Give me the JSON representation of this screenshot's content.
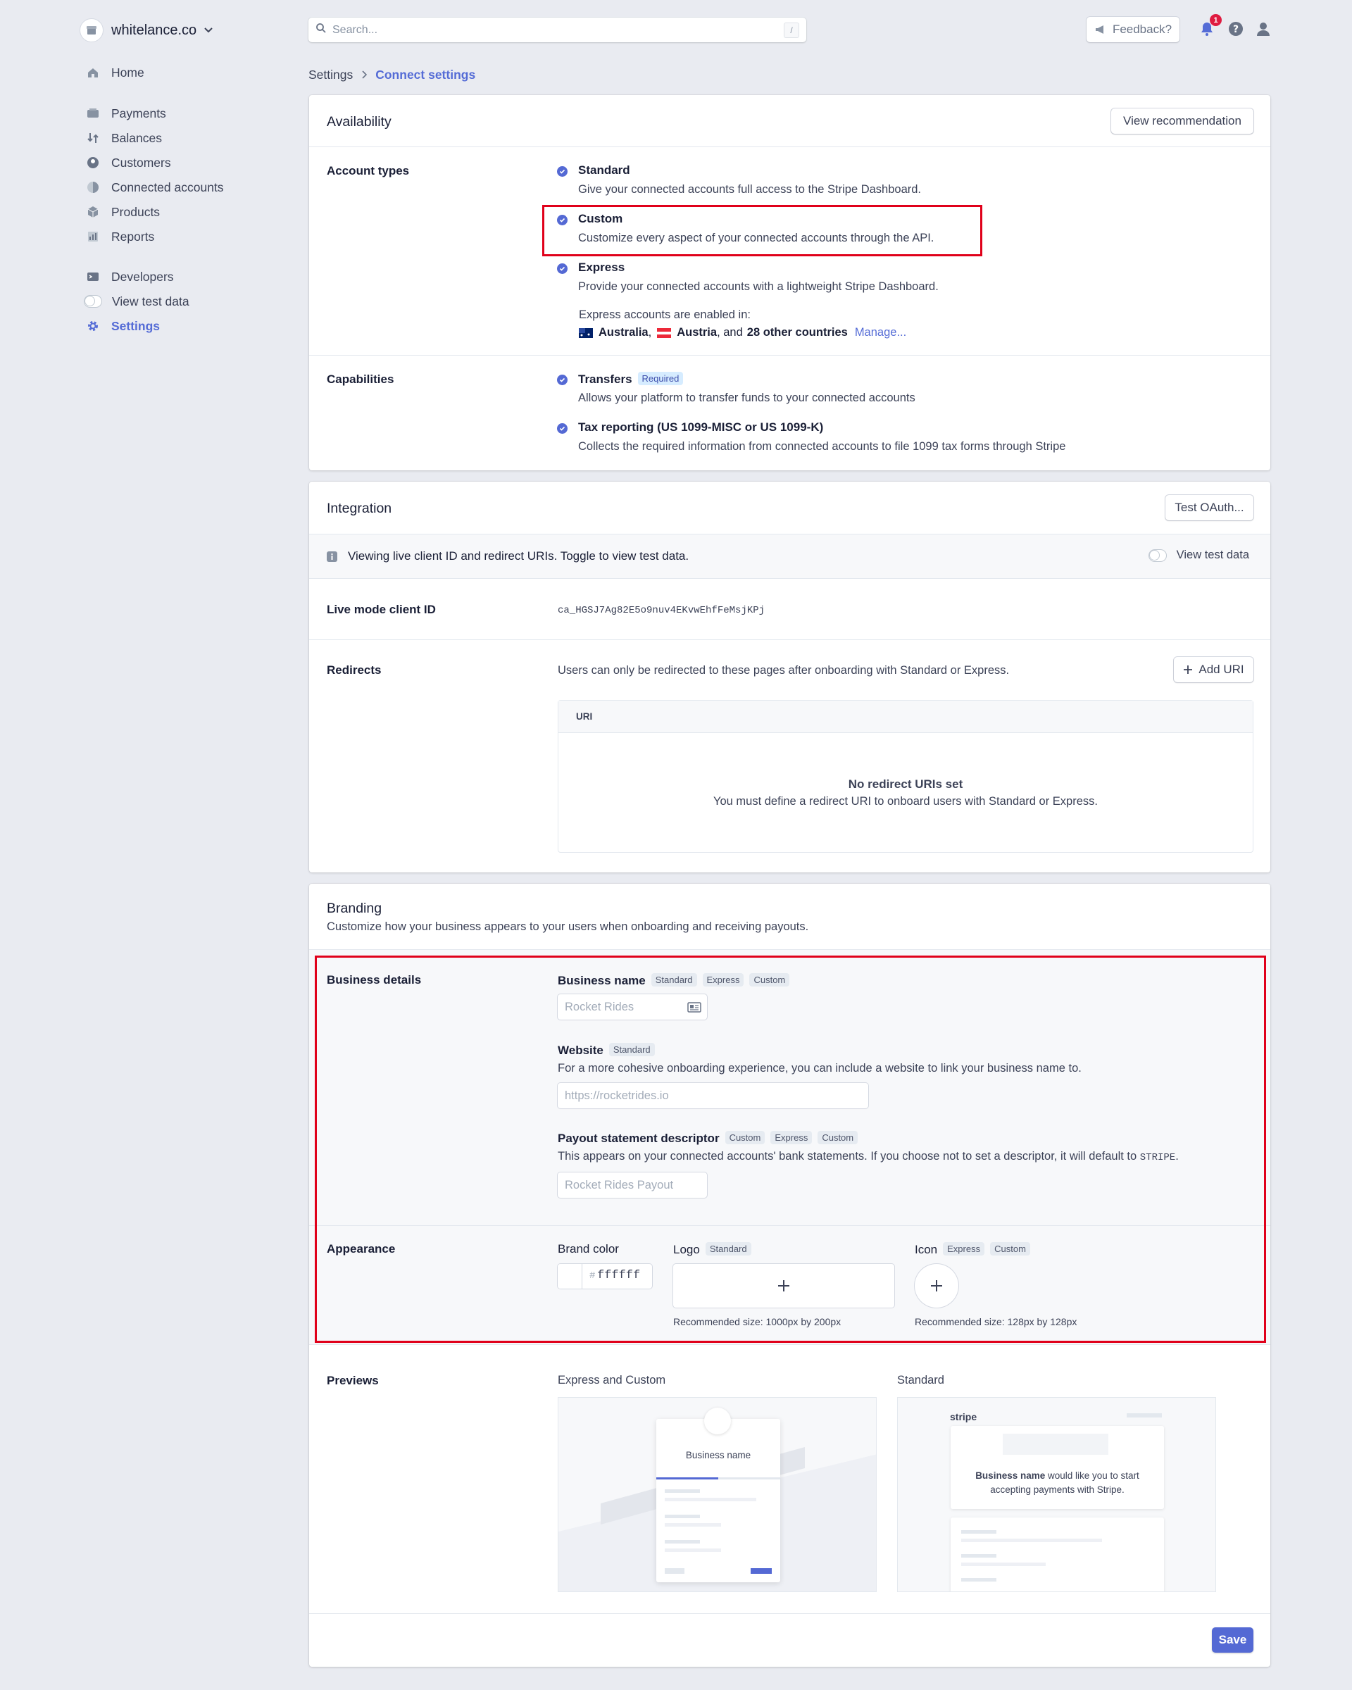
{
  "account": {
    "name": "whitelance.co"
  },
  "search": {
    "placeholder": "Search...",
    "shortcut": "/"
  },
  "topbar": {
    "feedback": "Feedback?",
    "notification_count": "1"
  },
  "sidebar": {
    "items": [
      {
        "label": "Home"
      },
      {
        "label": "Payments"
      },
      {
        "label": "Balances"
      },
      {
        "label": "Customers"
      },
      {
        "label": "Connected accounts"
      },
      {
        "label": "Products"
      },
      {
        "label": "Reports"
      },
      {
        "label": "Developers"
      },
      {
        "label": "View test data"
      },
      {
        "label": "Settings"
      }
    ]
  },
  "breadcrumb": {
    "parent": "Settings",
    "current": "Connect settings"
  },
  "availability": {
    "title": "Availability",
    "button": "View recommendation",
    "account_types_label": "Account types",
    "types": [
      {
        "title": "Standard",
        "desc": "Give your connected accounts full access to the Stripe Dashboard."
      },
      {
        "title": "Custom",
        "desc": "Customize every aspect of your connected accounts through the API."
      },
      {
        "title": "Express",
        "desc": "Provide your connected accounts with a lightweight Stripe Dashboard."
      }
    ],
    "express_enabled_in": "Express accounts are enabled in:",
    "country1": "Australia",
    "country2": "Austria",
    "and_text": ", and",
    "others": "28 other countries",
    "manage": "Manage...",
    "capabilities_label": "Capabilities",
    "capabilities": [
      {
        "title": "Transfers",
        "badge": "Required",
        "desc": "Allows your platform to transfer funds to your connected accounts"
      },
      {
        "title": "Tax reporting (US 1099-MISC or US 1099-K)",
        "desc": "Collects the required information from connected accounts to file 1099 tax forms through Stripe"
      }
    ]
  },
  "integration": {
    "title": "Integration",
    "button": "Test OAuth...",
    "notice": "Viewing live client ID and redirect URIs. Toggle to view test data.",
    "toggle_label": "View test data",
    "client_id_label": "Live mode client ID",
    "client_id": "ca_HGSJ7Ag82E5o9nuv4EKvwEhfFeMsjKPj",
    "redirects_label": "Redirects",
    "redirects_desc": "Users can only be redirected to these pages after onboarding with Standard or Express.",
    "add_uri": "Add URI",
    "uri_header": "URI",
    "empty_title": "No redirect URIs set",
    "empty_desc": "You must define a redirect URI to onboard users with Standard or Express."
  },
  "branding": {
    "title": "Branding",
    "subtitle": "Customize how your business appears to your users when onboarding and receiving payouts.",
    "business_details_label": "Business details",
    "business_name_label": "Business name",
    "business_name_badges": [
      "Standard",
      "Express",
      "Custom"
    ],
    "business_name_placeholder": "Rocket Rides",
    "website_label": "Website",
    "website_badge": "Standard",
    "website_desc": "For a more cohesive onboarding experience, you can include a website to link your business name to.",
    "website_placeholder": "https://rocketrides.io",
    "descriptor_label": "Payout statement descriptor",
    "descriptor_badges": [
      "Custom",
      "Express",
      "Custom"
    ],
    "descriptor_desc": "This appears on your connected accounts' bank statements. If you choose not to set a descriptor, it will default to",
    "descriptor_default": "STRIPE",
    "descriptor_end": ".",
    "descriptor_placeholder": "Rocket Rides Payout",
    "appearance_label": "Appearance",
    "brand_color_label": "Brand color",
    "brand_color_hash": "#",
    "brand_color_value": "ffffff",
    "logo_label": "Logo",
    "logo_badge": "Standard",
    "logo_hint": "Recommended size: 1000px by 200px",
    "icon_label": "Icon",
    "icon_badges": [
      "Express",
      "Custom"
    ],
    "icon_hint": "Recommended size: 128px by 128px",
    "previews_label": "Previews",
    "preview_express": "Express and Custom",
    "preview_standard": "Standard",
    "preview_business_name": "Business name",
    "preview_stripe": "stripe",
    "preview_standard_bold": "Business name",
    "preview_standard_text1": "would like you to start",
    "preview_standard_text2": "accepting payments with Stripe.",
    "save": "Save"
  },
  "colors": {
    "accent": "#556cd6",
    "highlight": "#e0001a"
  }
}
